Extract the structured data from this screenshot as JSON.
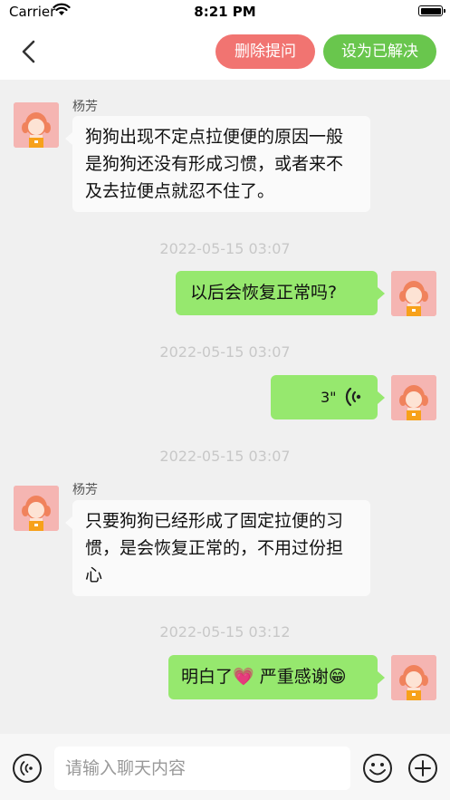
{
  "status_bar": {
    "carrier": "Carrier",
    "time": "8:21 PM"
  },
  "header": {
    "delete_label": "删除提问",
    "resolve_label": "设为已解决"
  },
  "colors": {
    "delete_button": "#f17471",
    "resolve_button": "#69c64d",
    "outgoing_bubble": "#96e86e",
    "incoming_bubble": "#fafafa",
    "chat_background": "#f0f0f0"
  },
  "messages": [
    {
      "direction": "incoming",
      "sender": "杨芳",
      "text": "狗狗出现不定点拉便便的原因一般是狗狗还没有形成习惯，或者来不及去拉便点就忍不住了。"
    },
    {
      "timestamp": "2022-05-15 03:07"
    },
    {
      "direction": "outgoing",
      "text": "以后会恢复正常吗?"
    },
    {
      "timestamp": "2022-05-15 03:07"
    },
    {
      "direction": "outgoing",
      "type": "voice",
      "duration": "3\""
    },
    {
      "timestamp": "2022-05-15 03:07"
    },
    {
      "direction": "incoming",
      "sender": "杨芳",
      "text": "只要狗狗已经形成了固定拉便的习惯，是会恢复正常的，不用过份担心"
    },
    {
      "timestamp": "2022-05-15 03:12"
    },
    {
      "direction": "outgoing",
      "text": "明白了💗 严重感谢😁"
    }
  ],
  "input": {
    "placeholder": "请输入聊天内容",
    "value": ""
  },
  "icons": [
    "back-icon",
    "voice-icon",
    "emoji-icon",
    "plus-icon",
    "wifi-icon",
    "battery-icon"
  ]
}
